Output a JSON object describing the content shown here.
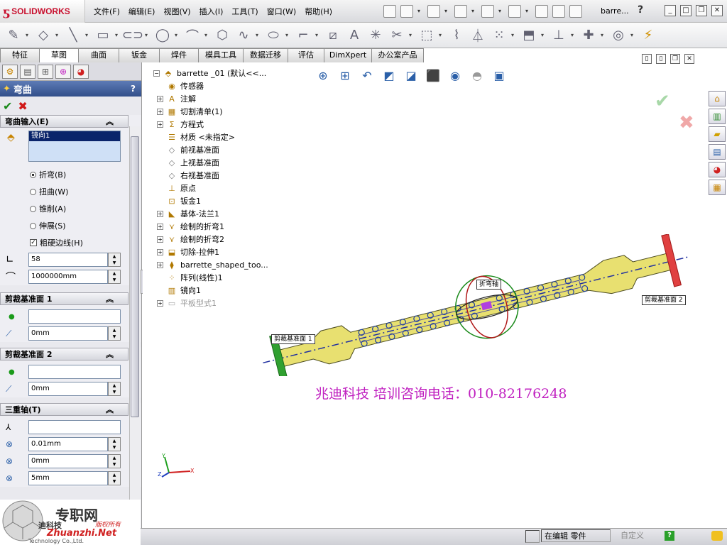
{
  "app": {
    "logo": "SOLIDWORKS",
    "doc_title": "barre...",
    "help": "?"
  },
  "menu": [
    "文件(F)",
    "编辑(E)",
    "视图(V)",
    "插入(I)",
    "工具(T)",
    "窗口(W)",
    "帮助(H)"
  ],
  "tabs": [
    "特征",
    "草图",
    "曲面",
    "钣金",
    "焊件",
    "模具工具",
    "数据迁移",
    "评估",
    "DimXpert",
    "办公室产品"
  ],
  "active_tab": 1,
  "property_manager": {
    "title": "弯曲",
    "help": "?",
    "groups": {
      "bend_input": {
        "header": "弯曲输入(E)",
        "selection": "镜向1",
        "options": [
          {
            "label": "折弯(B)",
            "checked": true
          },
          {
            "label": "扭曲(W)",
            "checked": false
          },
          {
            "label": "锥削(A)",
            "checked": false
          },
          {
            "label": "伸展(S)",
            "checked": false
          }
        ],
        "checkbox_label": "粗硬边线(H)",
        "angle_value": "58",
        "radius_value": "1000000mm"
      },
      "trim_plane_1": {
        "header": "剪裁基准面 1",
        "distance": "0mm"
      },
      "trim_plane_2": {
        "header": "剪裁基准面 2",
        "distance": "0mm"
      },
      "triad": {
        "header": "三重轴(T)",
        "x_value": "0.01mm",
        "y_value": "0mm",
        "z_value": "5mm"
      }
    }
  },
  "feature_tree": [
    {
      "label": "barrette _01  (默认<<...",
      "expand": "minus",
      "icon": "part"
    },
    {
      "label": "传感器",
      "expand": "",
      "icon": "sensor"
    },
    {
      "label": "注解",
      "expand": "plus",
      "icon": "annotation"
    },
    {
      "label": "切割清单(1)",
      "expand": "plus",
      "icon": "cutlist"
    },
    {
      "label": "方程式",
      "expand": "plus",
      "icon": "equation"
    },
    {
      "label": "材质 <未指定>",
      "expand": "",
      "icon": "material"
    },
    {
      "label": "前视基准面",
      "expand": "",
      "icon": "plane"
    },
    {
      "label": "上视基准面",
      "expand": "",
      "icon": "plane"
    },
    {
      "label": "右视基准面",
      "expand": "",
      "icon": "plane"
    },
    {
      "label": "原点",
      "expand": "",
      "icon": "origin"
    },
    {
      "label": "钣金1",
      "expand": "",
      "icon": "sheetmetal"
    },
    {
      "label": "基体-法兰1",
      "expand": "plus",
      "icon": "flange"
    },
    {
      "label": "绘制的折弯1",
      "expand": "plus",
      "icon": "bend"
    },
    {
      "label": "绘制的折弯2",
      "expand": "plus",
      "icon": "bend"
    },
    {
      "label": "切除-拉伸1",
      "expand": "plus",
      "icon": "cut"
    },
    {
      "label": "barrette_shaped_too...",
      "expand": "plus",
      "icon": "tool"
    },
    {
      "label": "阵列(线性)1",
      "expand": "",
      "icon": "pattern"
    },
    {
      "label": "镜向1",
      "expand": "",
      "icon": "mirror"
    },
    {
      "label": "平板型式1",
      "expand": "plus",
      "icon": "flat",
      "suppressed": true
    }
  ],
  "viewport": {
    "callout_bend": "折弯轴",
    "callout_trim1": "剪裁基准面 1",
    "callout_trim2": "剪裁基准面 2",
    "axes": {
      "x": "X",
      "y": "Y",
      "z": "Z"
    },
    "banner": "兆迪科技    培训咨询电话：010-82176248"
  },
  "status": {
    "editing": "在编辑 零件",
    "custom": "自定义",
    "help_badge": "?"
  },
  "watermark": {
    "brand": "专职网",
    "url": "Zhuanzhi.Net",
    "left_text": "迪科技",
    "company": "Technology Co.,Ltd.",
    "stamp": "版权所有"
  },
  "colors": {
    "title_blue": "#324f8a",
    "part_yellow": "#e8e070",
    "accent_magenta": "#c020c0",
    "ok_green": "#1a8a1a",
    "cancel_red": "#d01818"
  }
}
